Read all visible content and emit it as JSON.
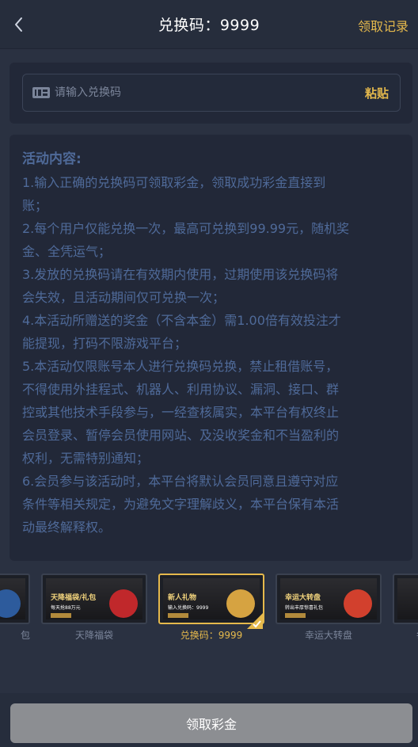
{
  "header": {
    "title": "兑换码：9999",
    "records_label": "领取记录"
  },
  "redeem": {
    "placeholder": "请输入兑换码",
    "value": "",
    "paste_label": "粘贴"
  },
  "rules": {
    "title": "活动内容:",
    "lines": [
      "1.输入正确的兑换码可领取彩金，领取成功彩金直接到",
      "账；",
      "2.每个用户仅能兑换一次，最高可兑换到99.99元，随机奖",
      "金、全凭运气；",
      "3.发放的兑换码请在有效期内使用，过期使用该兑换码将",
      "会失效，且活动期间仅可兑换一次；",
      "4.本活动所赠送的奖金（不含本金）需1.00倍有效投注才",
      "能提现，打码不限游戏平台；",
      "5.本活动仅限账号本人进行兑换码兑换，禁止租借账号，",
      "不得使用外挂程式、机器人、利用协议、漏洞、接口、群",
      "控或其他技术手段参与，一经查核属实，本平台有权终止",
      "会员登录、暂停会员使用网站、及没收奖金和不当盈利的",
      "权利，无需特别通知；",
      "6.会员参与该活动时，本平台将默认会员同意且遵守对应",
      "条件等相关规定，为避免文字理解歧义，本平台保有本活",
      "动最终解释权。"
    ]
  },
  "banners": [
    {
      "label": "包",
      "headline": "",
      "sub": "",
      "active": false,
      "art_color": "#2d5b9c"
    },
    {
      "label": "天降福袋",
      "headline": "天降福袋/礼包",
      "sub": "每天抢88万元",
      "active": false,
      "art_color": "#c0282b"
    },
    {
      "label": "兑换码：9999",
      "headline": "新人礼物",
      "sub": "输入兑换码：9999",
      "active": true,
      "art_color": "#d6a341"
    },
    {
      "label": "幸运大转盘",
      "headline": "幸运大转盘",
      "sub": "转出丰厚惊喜礼包",
      "active": false,
      "art_color": "#d2402d"
    },
    {
      "label": "每",
      "headline": "",
      "sub": "",
      "active": false,
      "art_color": "#3b3b3b"
    }
  ],
  "footer": {
    "claim_label": "领取彩金"
  },
  "colors": {
    "accent": "#e5b94c",
    "rules_text": "#4f6a99",
    "background": "#2a3141",
    "card": "#222838",
    "disabled_button": "#8c8e92"
  }
}
